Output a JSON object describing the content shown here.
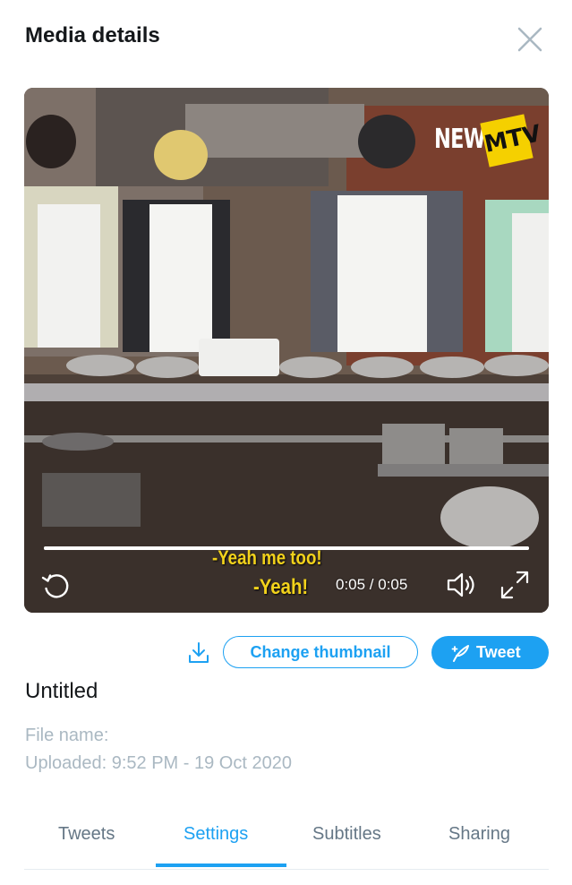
{
  "header": {
    "title": "Media details"
  },
  "video": {
    "overlay_logo": {
      "text": "NEWS",
      "badge": "MTV"
    },
    "subtitles": [
      "-Yeah me too!",
      "-Yeah!"
    ],
    "time": "0:05 / 0:05",
    "progress": 1.0
  },
  "actions": {
    "change_thumbnail_label": "Change thumbnail",
    "tweet_label": "Tweet"
  },
  "media": {
    "title": "Untitled",
    "file_name_label": "File name:",
    "uploaded": "Uploaded: 9:52 PM - 19 Oct 2020"
  },
  "tabs": [
    {
      "label": "Tweets",
      "active": false
    },
    {
      "label": "Settings",
      "active": true
    },
    {
      "label": "Subtitles",
      "active": false
    },
    {
      "label": "Sharing",
      "active": false
    }
  ],
  "colors": {
    "accent": "#1da1f2",
    "muted": "#aab8c2",
    "subtitle": "#f2d21b"
  },
  "icons": [
    "close-icon",
    "replay-icon",
    "volume-icon",
    "fullscreen-icon",
    "download-icon",
    "quill-icon"
  ]
}
